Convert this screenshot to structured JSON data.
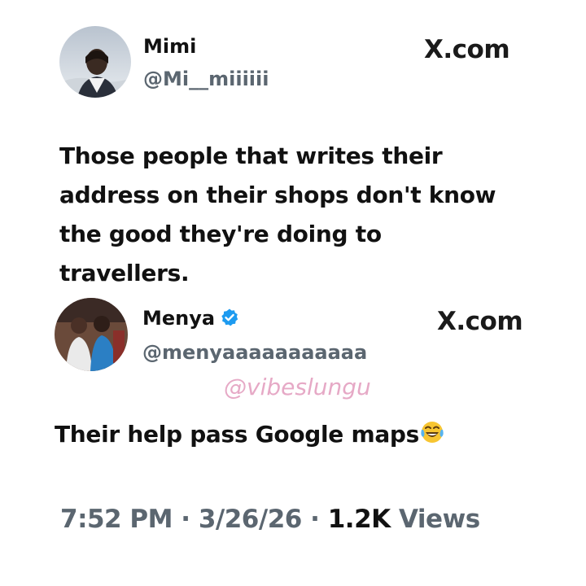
{
  "tweet": {
    "author": {
      "name": "Mimi",
      "handle": "@Mi__miiiiii",
      "avatar": "profile-photo-woman"
    },
    "brand": "X.com",
    "text_lines": [
      "Those people that writes their",
      "address on their shops don't know",
      "the good they're doing to",
      "travellers."
    ]
  },
  "reply": {
    "author": {
      "name": "Menya",
      "handle": "@menyaaaaaaaaaaa",
      "verified": true,
      "verified_color": "#1d9bf0",
      "avatar": "profile-photo-couple"
    },
    "brand": "X.com",
    "watermark": "@vibeslungu",
    "text": "Their help pass Google maps",
    "emoji": "😂"
  },
  "meta": {
    "time": "7:52 PM",
    "separator": "·",
    "date": "3/26/26",
    "views_count": "1.2K",
    "views_label": "Views"
  }
}
